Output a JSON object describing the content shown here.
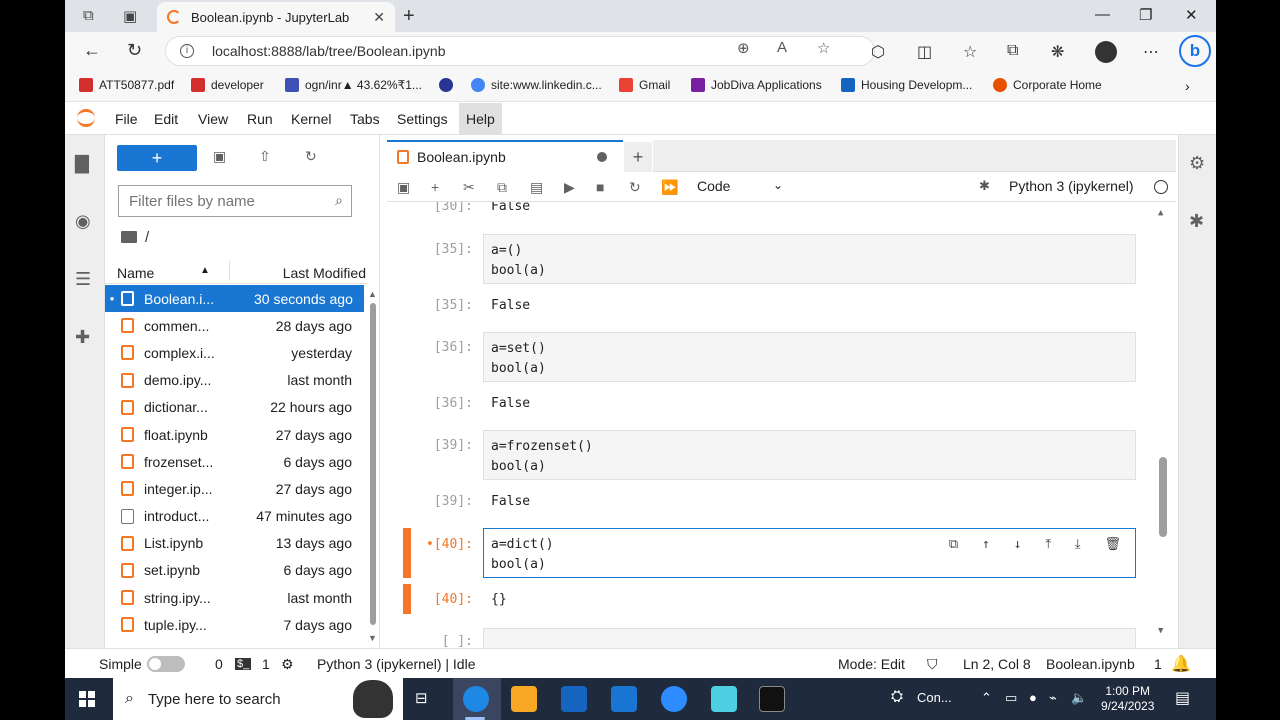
{
  "browser": {
    "tab_title": "Boolean.ipynb - JupyterLab",
    "url": "localhost:8888/lab/tree/Boolean.ipynb",
    "bookmarks": [
      {
        "label": "ATT50877.pdf",
        "color": "#d32f2f"
      },
      {
        "label": "developer",
        "color": "#d32f2f"
      },
      {
        "label": "ogn/inr▲ 43.62%₹1...",
        "color": "#3f51b5"
      },
      {
        "label": "",
        "color": "#283593"
      },
      {
        "label": "site:www.linkedin.c...",
        "color": "#4285f4"
      },
      {
        "label": "Gmail",
        "color": "#ea4335"
      },
      {
        "label": "JobDiva Applications",
        "color": "#7b1fa2"
      },
      {
        "label": "Housing Developm...",
        "color": "#1565c0"
      },
      {
        "label": "Corporate Home",
        "color": "#e65100"
      }
    ]
  },
  "menubar": [
    "File",
    "Edit",
    "View",
    "Run",
    "Kernel",
    "Tabs",
    "Settings",
    "Help"
  ],
  "filebrowser": {
    "new_label": "+",
    "filter_placeholder": "Filter files by name",
    "path": "/",
    "col_name": "Name",
    "col_modified": "Last Modified",
    "files": [
      {
        "name": "Boolean.i...",
        "modified": "30 seconds ago",
        "selected": true,
        "running": true,
        "kind": "notebook"
      },
      {
        "name": "commen...",
        "modified": "28 days ago",
        "kind": "notebook"
      },
      {
        "name": "complex.i...",
        "modified": "yesterday",
        "kind": "notebook"
      },
      {
        "name": "demo.ipy...",
        "modified": "last month",
        "kind": "notebook"
      },
      {
        "name": "dictionar...",
        "modified": "22 hours ago",
        "kind": "notebook"
      },
      {
        "name": "float.ipynb",
        "modified": "27 days ago",
        "kind": "notebook"
      },
      {
        "name": "frozenset...",
        "modified": "6 days ago",
        "kind": "notebook"
      },
      {
        "name": "integer.ip...",
        "modified": "27 days ago",
        "kind": "notebook"
      },
      {
        "name": "introduct...",
        "modified": "47 minutes ago",
        "kind": "file"
      },
      {
        "name": "List.ipynb",
        "modified": "13 days ago",
        "kind": "notebook"
      },
      {
        "name": "set.ipynb",
        "modified": "6 days ago",
        "kind": "notebook"
      },
      {
        "name": "string.ipy...",
        "modified": "last month",
        "kind": "notebook"
      },
      {
        "name": "tuple.ipy...",
        "modified": "7 days ago",
        "kind": "notebook"
      }
    ]
  },
  "notebook": {
    "tab_title": "Boolean.ipynb",
    "cell_type": "Code",
    "kernel": "Python 3 (ipykernel)",
    "cells": {
      "c30_out_prompt": "[30]:",
      "c30_out": "False",
      "c35_in_prompt": "[35]:",
      "c35_line1": "a=()",
      "c35_line2": "bool(a)",
      "c35_out_prompt": "[35]:",
      "c35_out": "False",
      "c36_in_prompt": "[36]:",
      "c36_line1": "a=set()",
      "c36_line2": "bool(a)",
      "c36_out_prompt": "[36]:",
      "c36_out": "False",
      "c39_in_prompt": "[39]:",
      "c39_line1": "a=frozenset()",
      "c39_line2": "bool(a)",
      "c39_out_prompt": "[39]:",
      "c39_out": "False",
      "c40_in_prompt": "•[40]:",
      "c40_line1": "a=dict()",
      "c40_line2": "bool(a)",
      "c40_out_prompt": "[40]:",
      "c40_out": "{}",
      "next_prompt": "[ ]:"
    }
  },
  "statusbar": {
    "simple": "Simple",
    "terminals": "0",
    "kernels": "1",
    "kernel_status": "Python 3 (ipykernel) | Idle",
    "mode": "Mode: Edit",
    "position": "Ln 2, Col 8",
    "filename": "Boolean.ipynb",
    "notifications": "1"
  },
  "taskbar": {
    "search_placeholder": "Type here to search",
    "tray_app": "Con...",
    "time": "1:00 PM",
    "date": "9/24/2023"
  }
}
